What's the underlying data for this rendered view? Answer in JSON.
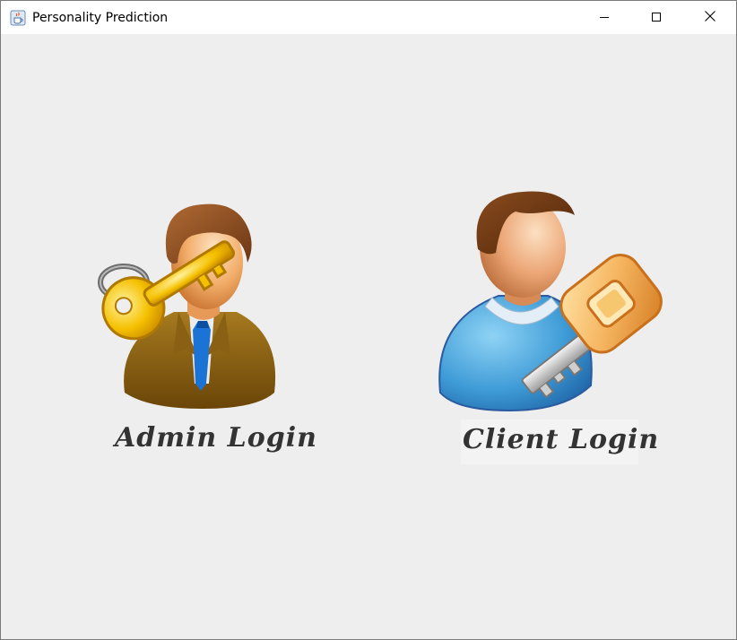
{
  "window": {
    "title": "Personality Prediction",
    "app_icon": "java-cup-icon",
    "controls": [
      "minimize-icon",
      "maximize-icon",
      "close-icon"
    ]
  },
  "tiles": {
    "admin": {
      "label": "Admin Login",
      "icon": "admin-user-key-icon"
    },
    "client": {
      "label": "Client Login",
      "icon": "client-user-key-icon"
    }
  }
}
